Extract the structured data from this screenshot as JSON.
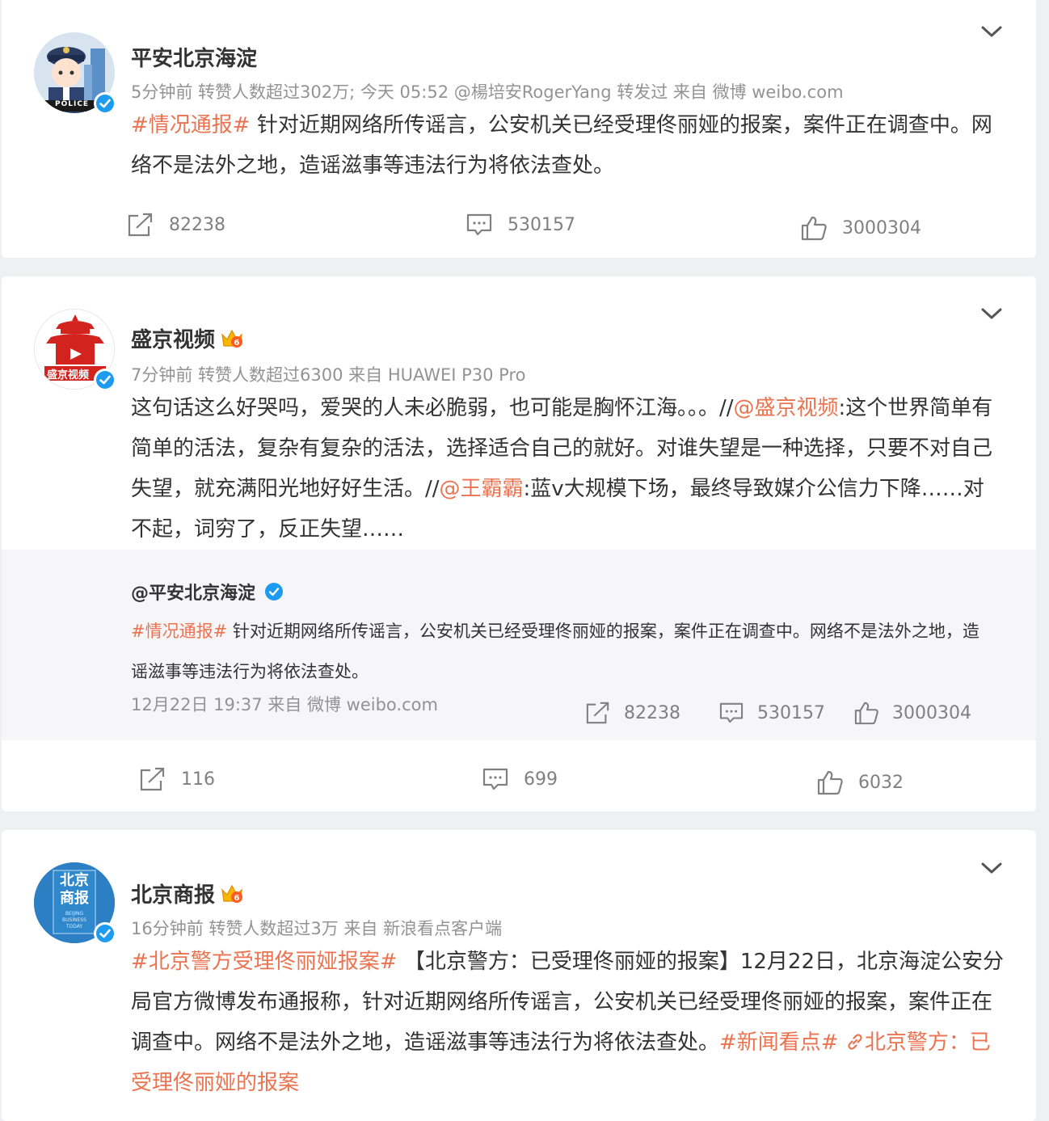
{
  "posts": [
    {
      "user": "平安北京海淀",
      "meta": "5分钟前  转赞人数超过302万; 今天 05:52 @楊培安RogerYang 转发过   来自 微博 weibo.com",
      "text": {
        "tag": "#情况通报#",
        "body": " 针对近期网络所传谣言，公安机关已经受理佟丽娅的报案，案件正在调查中。网络不是法外之地，造谣滋事等违法行为将依法查处。"
      },
      "actions": {
        "repost": "82238",
        "comment": "530157",
        "like": "3000304"
      },
      "avatar_label": "POLICE"
    },
    {
      "user": "盛京视频",
      "meta": "7分钟前  转赞人数超过6300  来自 HUAWEI P30 Pro",
      "text": {
        "part1": "这句话这么好哭吗，爱哭的人未必脆弱，也可能是胸怀江海。。。//",
        "mention1": "@盛京视频",
        "part2": ":这个世界简单有简单的活法，复杂有复杂的活法，选择适合自己的就好。对谁失望是一种选择，只要不对自己失望，就充满阳光地好好生活。//",
        "mention2": "@王霸霸",
        "part3": ":蓝v大规模下场，最终导致媒介公信力下降……对不起，词穷了，反正失望……"
      },
      "avatar_label": "盛京视频",
      "quote": {
        "user": "@平安北京海淀",
        "tag": "#情况通报#",
        "body": " 针对近期网络所传谣言，公安机关已经受理佟丽娅的报案，案件正在调查中。网络不是法外之地，造谣滋事等违法行为将依法查处。",
        "meta": "12月22日 19:37 来自 微博 weibo.com",
        "actions": {
          "repost": "82238",
          "comment": "530157",
          "like": "3000304"
        }
      },
      "actions": {
        "repost": "116",
        "comment": "699",
        "like": "6032"
      }
    },
    {
      "user": "北京商报",
      "meta": "16分钟前  转赞人数超过3万  来自 新浪看点客户端",
      "text": {
        "tag1": "#北京警方受理佟丽娅报案#",
        "body": " 【北京警方：已受理佟丽娅的报案】12月22日，北京海淀公安分局官方微博发布通报称，针对近期网络所传谣言，公安机关已经受理佟丽娅的报案，案件正在调查中。网络不是法外之地，造谣滋事等违法行为将依法查处。",
        "tag2": "#新闻看点#",
        "link": "北京警方：已受理佟丽娅的报案"
      },
      "avatar_label": "北京商报",
      "avatar_sub": "BEIJING BUSINESS TODAY"
    }
  ],
  "colors": {
    "accent": "#eb7350",
    "verified": "#1d9bf0",
    "meta": "#939393"
  }
}
